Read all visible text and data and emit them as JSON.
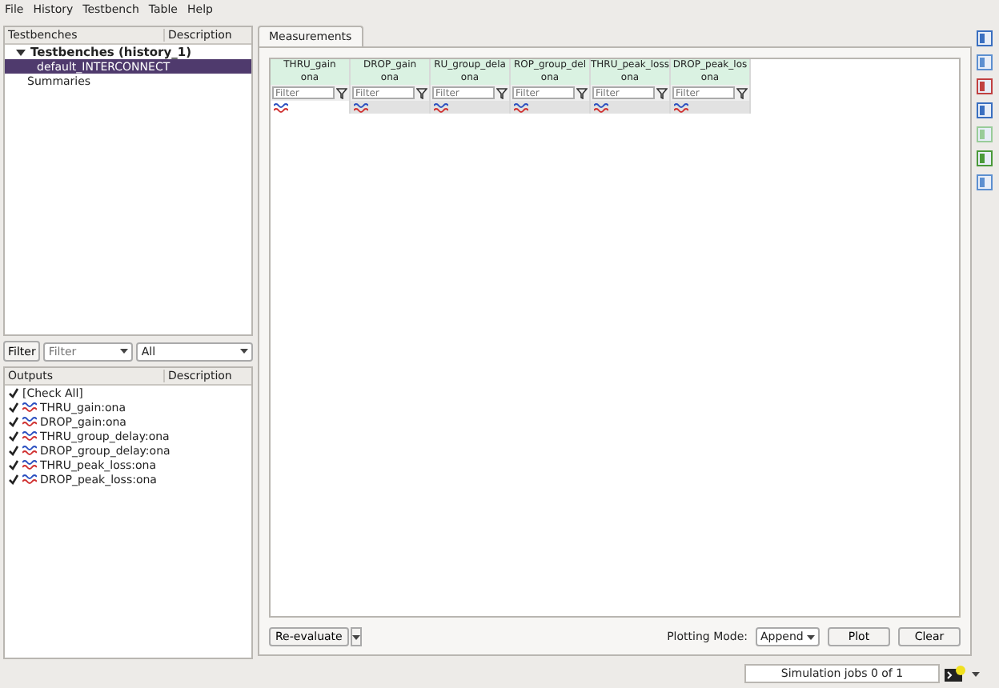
{
  "menu": [
    "File",
    "History",
    "Testbench",
    "Table",
    "Help"
  ],
  "testbenches": {
    "columns": [
      "Testbenches",
      "Description"
    ],
    "root": {
      "label": "Testbenches (history_1)",
      "expanded": true,
      "children": [
        {
          "label": "default_INTERCONNECT",
          "selected": true
        }
      ]
    },
    "items": [
      {
        "label": "Summaries",
        "selected": false
      }
    ]
  },
  "filter_bar": {
    "button": "Filter",
    "placeholder": "Filter",
    "scope": "All"
  },
  "outputs": {
    "columns": [
      "Outputs",
      "Description"
    ],
    "check_all": {
      "label": "[Check All]",
      "checked": true
    },
    "items": [
      {
        "label": "THRU_gain:ona",
        "checked": true
      },
      {
        "label": "DROP_gain:ona",
        "checked": true
      },
      {
        "label": "THRU_group_delay:ona",
        "checked": true
      },
      {
        "label": "DROP_group_delay:ona",
        "checked": true
      },
      {
        "label": "THRU_peak_loss:ona",
        "checked": true
      },
      {
        "label": "DROP_peak_loss:ona",
        "checked": true
      }
    ]
  },
  "tabs": [
    {
      "label": "Measurements",
      "selected": true
    }
  ],
  "table": {
    "columns": [
      {
        "name": "THRU_gain",
        "sub": "ona",
        "filter_placeholder": "Filter"
      },
      {
        "name": "DROP_gain",
        "sub": "ona",
        "filter_placeholder": "Filter"
      },
      {
        "name": "RU_group_dela",
        "sub": "ona",
        "filter_placeholder": "Filter"
      },
      {
        "name": "ROP_group_del",
        "sub": "ona",
        "filter_placeholder": "Filter"
      },
      {
        "name": "THRU_peak_loss",
        "sub": "ona",
        "filter_placeholder": "Filter"
      },
      {
        "name": "DROP_peak_los",
        "sub": "ona",
        "filter_placeholder": "Filter"
      }
    ]
  },
  "bottom": {
    "reevaluate": "Re-evaluate",
    "plotting_label": "Plotting Mode:",
    "plotting_mode": "Append",
    "plot": "Plot",
    "clear": "Clear"
  },
  "status": {
    "jobs": "Simulation jobs 0 of 1"
  }
}
